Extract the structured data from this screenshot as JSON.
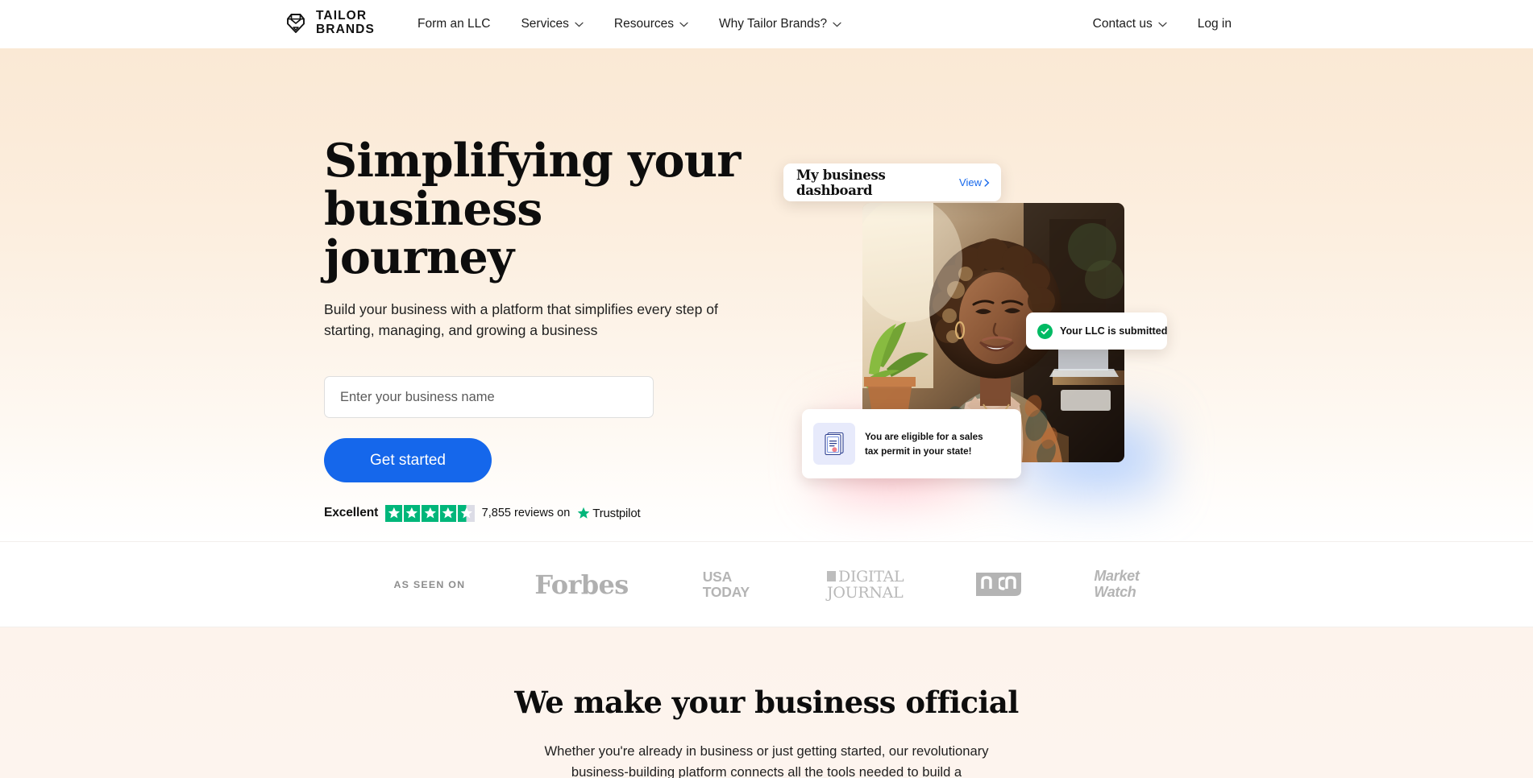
{
  "header": {
    "logo": {
      "line1": "TAILOR",
      "line2": "BRANDS",
      "icon": "tailor-brands-shield-icon"
    },
    "nav_left": [
      {
        "label": "Form an LLC",
        "has_dropdown": false
      },
      {
        "label": "Services",
        "has_dropdown": true
      },
      {
        "label": "Resources",
        "has_dropdown": true
      },
      {
        "label": "Why Tailor Brands?",
        "has_dropdown": true
      }
    ],
    "nav_right": [
      {
        "label": "Contact us",
        "has_dropdown": true
      },
      {
        "label": "Log in",
        "has_dropdown": false
      }
    ]
  },
  "hero": {
    "title_line1": "Simplifying your",
    "title_line2": "business journey",
    "subtitle": "Build your business with a platform that simplifies every step of starting, managing, and growing a business",
    "input_placeholder": "Enter your business name",
    "input_value": "",
    "cta_label": "Get started",
    "trustpilot": {
      "rating_word": "Excellent",
      "stars_filled": 4,
      "stars_half": 1,
      "reviews_text": "7,855 reviews on",
      "brand": "Trustpilot",
      "star_color": "#00B67A"
    },
    "cards": {
      "dashboard": {
        "title": "My business dashboard",
        "link": "View",
        "link_color": "#1567EB"
      },
      "llc": {
        "text": "Your LLC is submitted",
        "status_color": "#00BA63"
      },
      "tax": {
        "line1": "You are eligible for a sales",
        "line2": "tax permit in your state!",
        "icon": "certificate-document-icon"
      }
    },
    "image_alt": "Smiling woman with curly hair seated in a warmly lit office with a plant and laptop"
  },
  "press": {
    "label": "AS SEEN ON",
    "logos": [
      {
        "name": "Forbes"
      },
      {
        "name": "USA TODAY",
        "line1": "USA",
        "line2": "TODAY"
      },
      {
        "name": "DIGITAL JOURNAL",
        "line1": "DIGITAL",
        "line2": "JOURNAL"
      },
      {
        "name": "ncn",
        "text": "ncn"
      },
      {
        "name": "MarketWatch",
        "line1": "Market",
        "line2": "Watch"
      }
    ]
  },
  "official": {
    "title": "We make your business official",
    "sub_line1": "Whether you're already in business or just getting started, our revolutionary",
    "sub_line2": "business-building platform connects all the tools needed to build a"
  },
  "colors": {
    "accent_blue": "#1567EB",
    "trustpilot_green": "#00B67A",
    "success_green": "#00BA63",
    "hero_bg_top": "#FAE9D5",
    "official_bg": "#FDF3EC"
  }
}
